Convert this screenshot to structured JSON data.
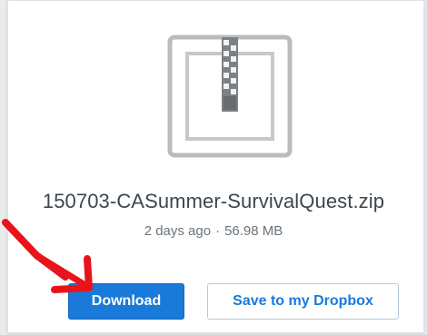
{
  "file": {
    "name": "150703-CASummer-SurvivalQuest.zip",
    "modified": "2 days ago",
    "separator": "·",
    "size": "56.98 MB"
  },
  "actions": {
    "download_label": "Download",
    "save_label": "Save to my Dropbox"
  },
  "icons": {
    "file_icon": "zip-file-icon",
    "annotation": "red-arrow-annotation"
  },
  "colors": {
    "primary": "#1a7ad9",
    "annotation_arrow": "#e8141b",
    "icon_gray": "#b9bcbf"
  }
}
